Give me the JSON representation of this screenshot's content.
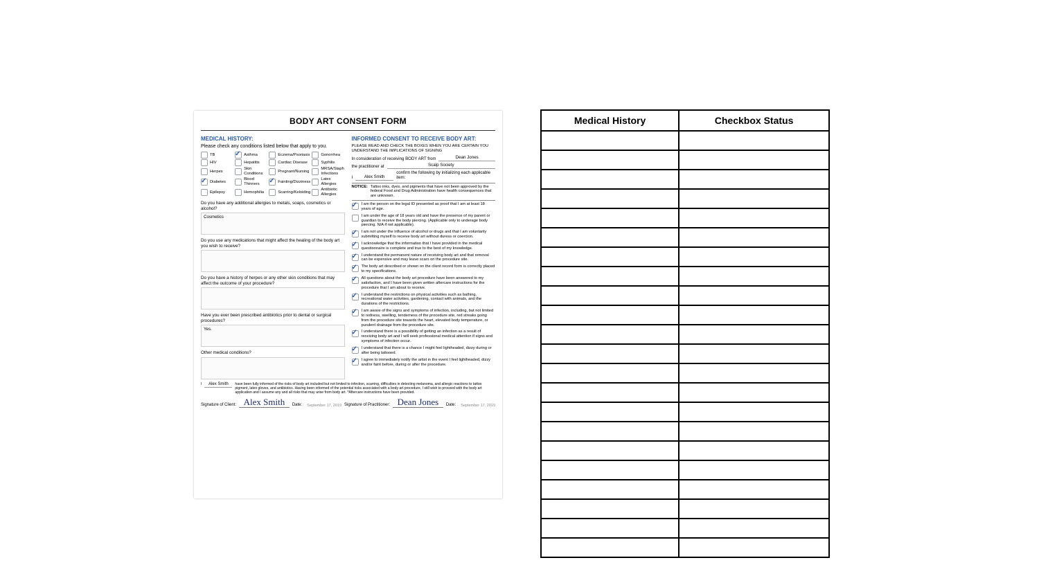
{
  "form": {
    "title": "BODY ART CONSENT FORM",
    "left": {
      "heading": "MEDICAL HISTORY:",
      "instruction": "Please check any conditions listed below that apply to you.",
      "conditions": [
        {
          "label": "TB",
          "checked": false
        },
        {
          "label": "Asthma",
          "checked": true
        },
        {
          "label": "Eczema/Psoriasis",
          "checked": false
        },
        {
          "label": "Gonorrhea",
          "checked": false
        },
        {
          "label": "HIV",
          "checked": false
        },
        {
          "label": "Hepatitis",
          "checked": false
        },
        {
          "label": "Cardiac Disease",
          "checked": false
        },
        {
          "label": "Syphilis",
          "checked": false
        },
        {
          "label": "Herpes",
          "checked": false
        },
        {
          "label": "Skin Conditions",
          "checked": false
        },
        {
          "label": "Pregnant/Nursing",
          "checked": false
        },
        {
          "label": "MRSA/Staph Infections",
          "checked": false
        },
        {
          "label": "Diabetes",
          "checked": true
        },
        {
          "label": "Blood Thinners",
          "checked": false
        },
        {
          "label": "Fainting/Dizziness",
          "checked": true
        },
        {
          "label": "Latex Allergies",
          "checked": false
        },
        {
          "label": "Epilepsy",
          "checked": false
        },
        {
          "label": "Hemophilia",
          "checked": false
        },
        {
          "label": "Scarring/Keloiding",
          "checked": false
        },
        {
          "label": "Antibiotic Allergies",
          "checked": false
        }
      ],
      "questions": [
        {
          "q": "Do you have any additional allergies to metals, soaps, cosmetics or alcohol?",
          "a": "Cosmetics"
        },
        {
          "q": "Do you use any medications that might affect the healing of the body art you wish to receive?",
          "a": ""
        },
        {
          "q": "Do you have a history of herpes or any other skin conditions that may affect the outcome of your procedure?",
          "a": ""
        },
        {
          "q": "Have you ever been prescribed antibiotics prior to dental or surgical procedures?",
          "a": "Yes."
        },
        {
          "q": "Other medical conditions?",
          "a": ""
        }
      ]
    },
    "right": {
      "heading": "INFORMED CONSENT TO RECEIVE BODY ART:",
      "lead": "PLEASE READ AND CHECK THE BOXES WHEN YOU ARE CERTAIN YOU UNDERSTAND THE IMPLICATIONS OF SIGNING",
      "line_from_pre": "In consideration of receiving BODY ART from",
      "line_from_val": "Dean Jones",
      "line_at_pre": "the practitioner at",
      "line_at_val": "Scalp Society",
      "line_i_pre": "I",
      "line_i_val": "Alex Smith",
      "line_i_post": "confirm the following by initializing each applicable item:",
      "notice_label": "NOTICE:",
      "notice_text": "Tattoo inks, dyes, and pigments that have not been approved by the federal Food and Drug Administration have health consequences that are unknown.",
      "items": [
        {
          "checked": true,
          "text": "I am the person on the legal ID presented as proof that I am at least 18 years of age."
        },
        {
          "checked": false,
          "text": "I am under the age of 18 years old and have the presence of my parent or guardian to receive the body piercing. (Applicable only to underage body piercing. N/A if not applicable)."
        },
        {
          "checked": true,
          "text": "I am not under the influence of alcohol or drugs and that I am voluntarily submitting myself to receive body art without duress or coercion."
        },
        {
          "checked": true,
          "text": "I acknowledge that the information that I have provided in the medical questionnaire is complete and true to the best of my knowledge."
        },
        {
          "checked": true,
          "text": "I understand the permanent nature of receiving body art and that removal can be expensive and may leave scars on the procedure site."
        },
        {
          "checked": true,
          "text": "The body art described or shown on the client record form is correctly placed to my specifications."
        },
        {
          "checked": true,
          "text": "All questions about the body art procedure have been answered to my satisfaction, and I have been given written aftercare instructions for the procedure that I am about to receive."
        },
        {
          "checked": true,
          "text": "I understand the restrictions on physical activities such as bathing, recreational water activities, gardening, contact with animals, and the durations of the restrictions."
        },
        {
          "checked": true,
          "text": "I am aware of the signs and symptoms of infection, including, but not limited to redness, swelling, tenderness of the procedure site, red streaks going from the procedure site towards the heart, elevated body temperature, or purulent drainage from the procedure site."
        },
        {
          "checked": true,
          "text": "I understand there is a possibility of getting an infection as a result of receiving body art and I will seek professional medical attention if signs and symptoms of infection occur."
        },
        {
          "checked": true,
          "text": "I understand that there is a chance I might feel lightheaded, dizzy during or after being tattooed."
        },
        {
          "checked": true,
          "text": "I agree to immediately notify the artist in the event I feel lightheaded, dizzy and/or faint before, during or after the procedure."
        }
      ]
    },
    "foot": {
      "i_val": "Alex Smith",
      "disclaimer": "have been fully informed of the risks of body art included but not limited to infection, scarring, difficulties in detecting melanoma, and allergic reactions to tattoo pigment, latex gloves, and antibiotics. Having been informed of the potential risks associated with a body art procedure, I still wish to proceed with the body art application and I assume any and all risks that may arise from body art. *Aftercare instructions have been provided.",
      "client_label": "Signature of Client:",
      "client_sig": "Alex Smith",
      "client_date": "September 17, 2019",
      "prac_label": "Signature of Practitioner:",
      "prac_sig": "Dean Jones",
      "prac_date": "September 17, 2019",
      "date_word": "Date:"
    }
  },
  "right_table": {
    "headers": [
      "Medical History",
      "Checkbox Status"
    ],
    "row_count": 22
  }
}
